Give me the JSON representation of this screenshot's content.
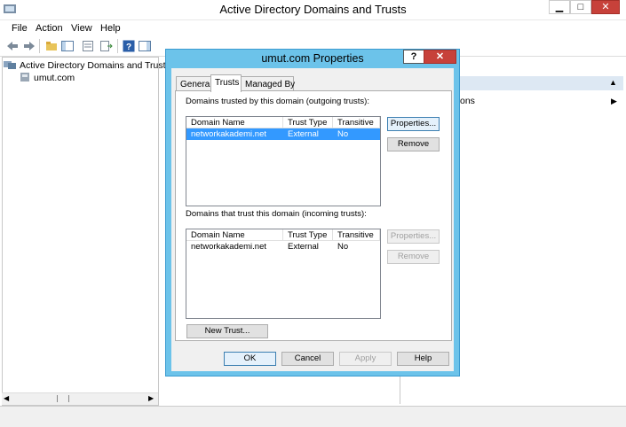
{
  "app": {
    "title": "Active Directory Domains and Trusts"
  },
  "window_controls": {
    "minimize": "▁",
    "maximize": "□",
    "close": "✕"
  },
  "menu": [
    "File",
    "Action",
    "View",
    "Help"
  ],
  "tree": {
    "root": "Active Directory Domains and Trust",
    "child": "umut.com"
  },
  "actions_text": "ons",
  "dialog": {
    "title": "umut.com Properties",
    "help": "?",
    "close": "✕",
    "tabs": [
      "General",
      "Trusts",
      "Managed By"
    ],
    "outgoing_label": "Domains trusted by this domain (outgoing trusts):",
    "incoming_label": "Domains that trust this domain (incoming trusts):",
    "columns": [
      "Domain Name",
      "Trust Type",
      "Transitive"
    ],
    "outgoing_rows": [
      [
        "networkakademi.net",
        "External",
        "No"
      ]
    ],
    "incoming_rows": [
      [
        "networkakademi.net",
        "External",
        "No"
      ]
    ],
    "buttons": {
      "properties": "Properties...",
      "remove": "Remove",
      "new_trust": "New Trust...",
      "ok": "OK",
      "cancel": "Cancel",
      "apply": "Apply",
      "help": "Help"
    }
  },
  "colors": {
    "dialog_border": "#6cc3ea",
    "selection": "#3399ff",
    "close": "#c7413a"
  }
}
